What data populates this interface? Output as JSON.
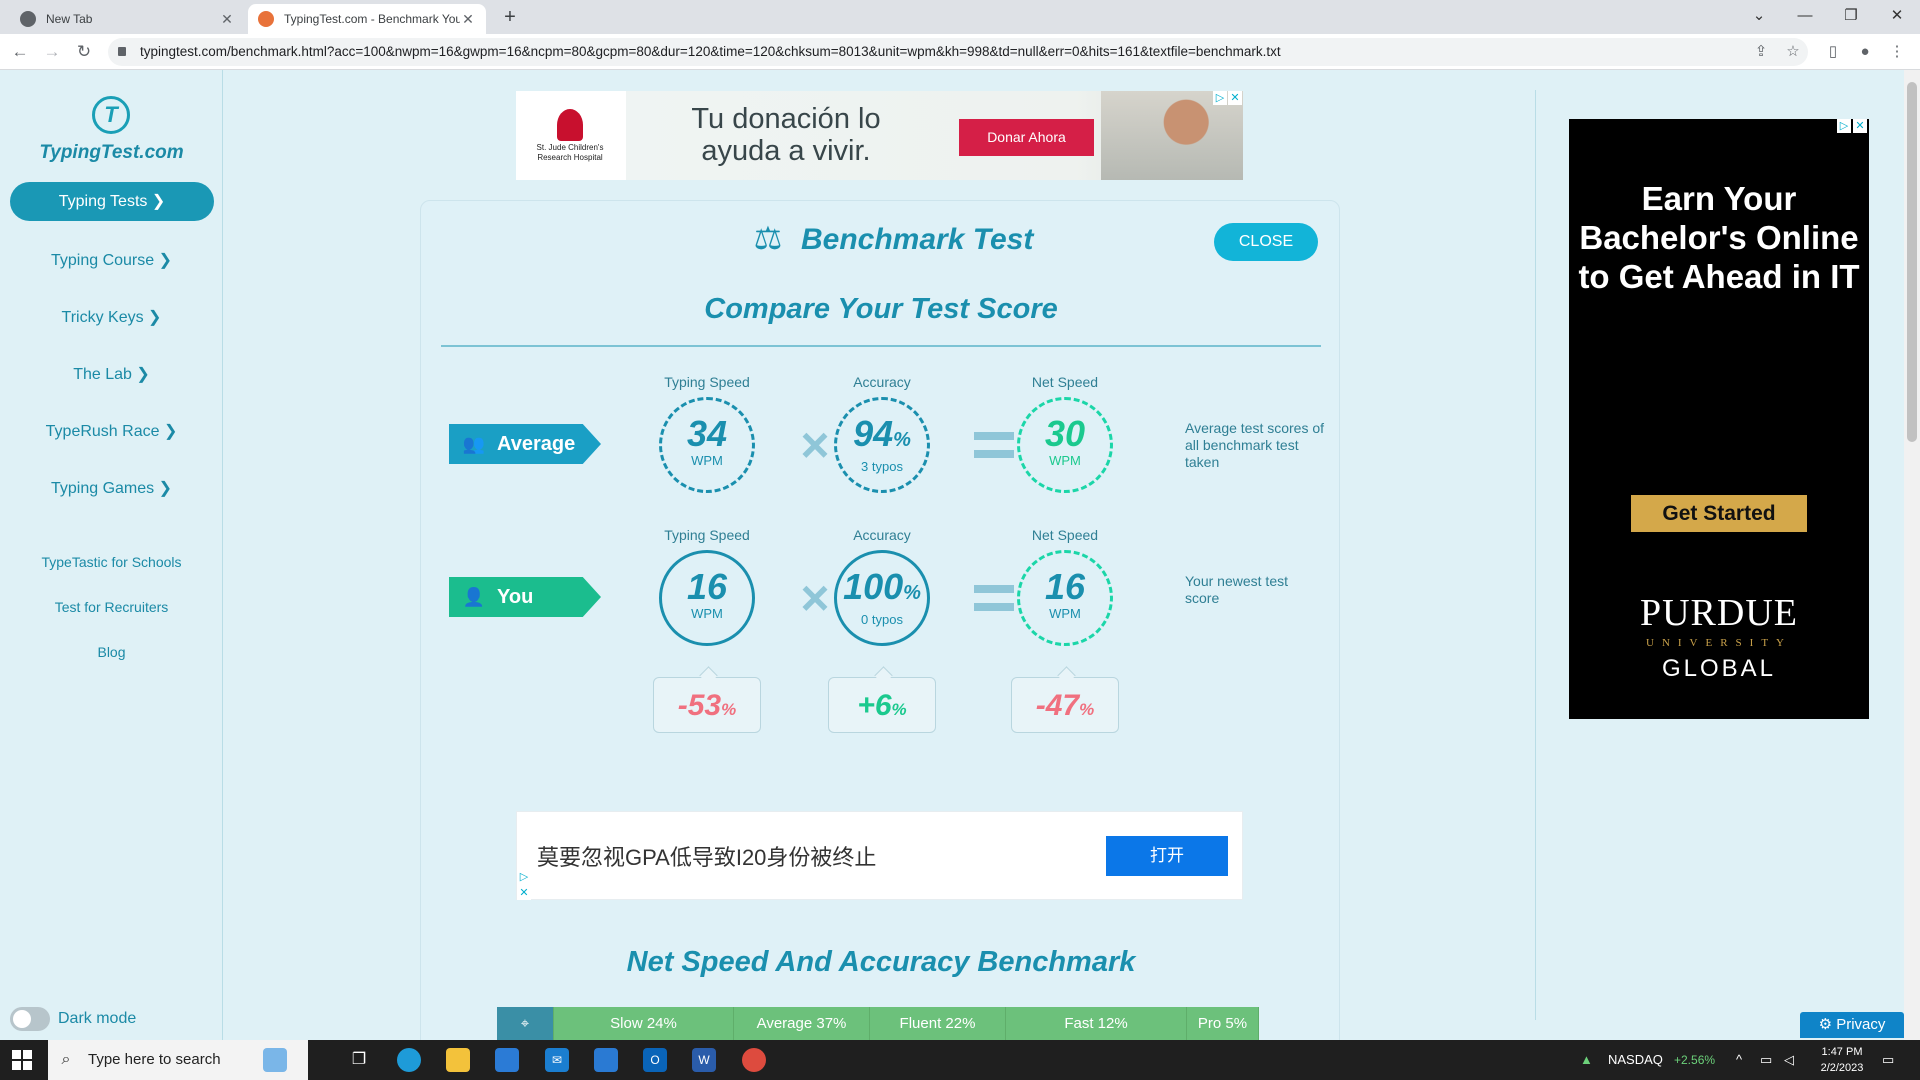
{
  "browser": {
    "tabs": [
      {
        "title": "New Tab"
      },
      {
        "title": "TypingTest.com - Benchmark You"
      }
    ],
    "new_tab": "+",
    "url": "typingtest.com/benchmark.html?acc=100&nwpm=16&gwpm=16&ncpm=80&gcpm=80&dur=120&time=120&chksum=8013&unit=wpm&kh=998&td=null&err=0&hits=161&textfile=benchmark.txt",
    "controls": {
      "dropdown": "⌄",
      "minimize": "—",
      "restore": "❐",
      "close": "✕"
    },
    "nav": {
      "back": "←",
      "forward": "→",
      "reload": "↻"
    }
  },
  "sidebar": {
    "logo_mark": "T",
    "logo": "TypingTest.com",
    "items": [
      {
        "label": "Typing Tests ❯"
      },
      {
        "label": "Typing Course ❯"
      },
      {
        "label": "Tricky Keys ❯"
      },
      {
        "label": "The Lab ❯"
      },
      {
        "label": "TypeRush Race ❯"
      },
      {
        "label": "Typing Games ❯"
      }
    ],
    "secondary": [
      "TypeTastic for Schools",
      "Test for Recruiters",
      "Blog"
    ],
    "dark_mode": "Dark mode"
  },
  "ad_top": {
    "logo": "St. Jude Children's Research Hospital",
    "text": "Tu donación lo ayuda a vivir.",
    "button": "Donar Ahora"
  },
  "benchmark": {
    "title": "Benchmark Test",
    "close": "CLOSE",
    "compare_title": "Compare Your Test Score",
    "average": {
      "tag": "Average",
      "typing_speed_label": "Typing Speed",
      "accuracy_label": "Accuracy",
      "net_speed_label": "Net Speed",
      "typing_speed": "34",
      "typing_unit": "WPM",
      "accuracy": "94",
      "accuracy_sub": "3 typos",
      "net_speed": "30",
      "net_unit": "WPM",
      "note": "Average test scores of all benchmark test taken"
    },
    "you": {
      "tag": "You",
      "typing_speed_label": "Typing Speed",
      "accuracy_label": "Accuracy",
      "net_speed_label": "Net Speed",
      "typing_speed": "16",
      "typing_unit": "WPM",
      "accuracy": "100",
      "accuracy_sub": "0 typos",
      "net_speed": "16",
      "net_unit": "WPM",
      "note": "Your newest test score"
    },
    "pct": "%",
    "diffs": [
      {
        "value": "-53",
        "unit": "%"
      },
      {
        "value": "+6",
        "unit": "%"
      },
      {
        "value": "-47",
        "unit": "%"
      }
    ],
    "colors": {
      "teal": "#1a8fae",
      "green": "#1bc98e",
      "red": "#f0707f"
    },
    "ad_mid": {
      "text": "莫要忽视GPA低导致I20身份被终止",
      "button": "打开"
    },
    "net_speed_title": "Net Speed And Accuracy Benchmark",
    "bar": [
      "Slow 24%",
      "Average 37%",
      "Fluent 22%",
      "Fast 12%",
      "Pro 5%"
    ]
  },
  "side_ad": {
    "headline": "Earn Your Bachelor's Online to Get Ahead in IT",
    "button": "Get Started",
    "brand1": "PURDUE",
    "brand2": "UNIVERSITY",
    "brand3": "GLOBAL"
  },
  "privacy": "Privacy",
  "taskbar": {
    "search": "Type here to search",
    "stock": "NASDAQ",
    "stock_change": "+2.56%",
    "time": "1:47 PM",
    "date": "2/2/2023"
  }
}
